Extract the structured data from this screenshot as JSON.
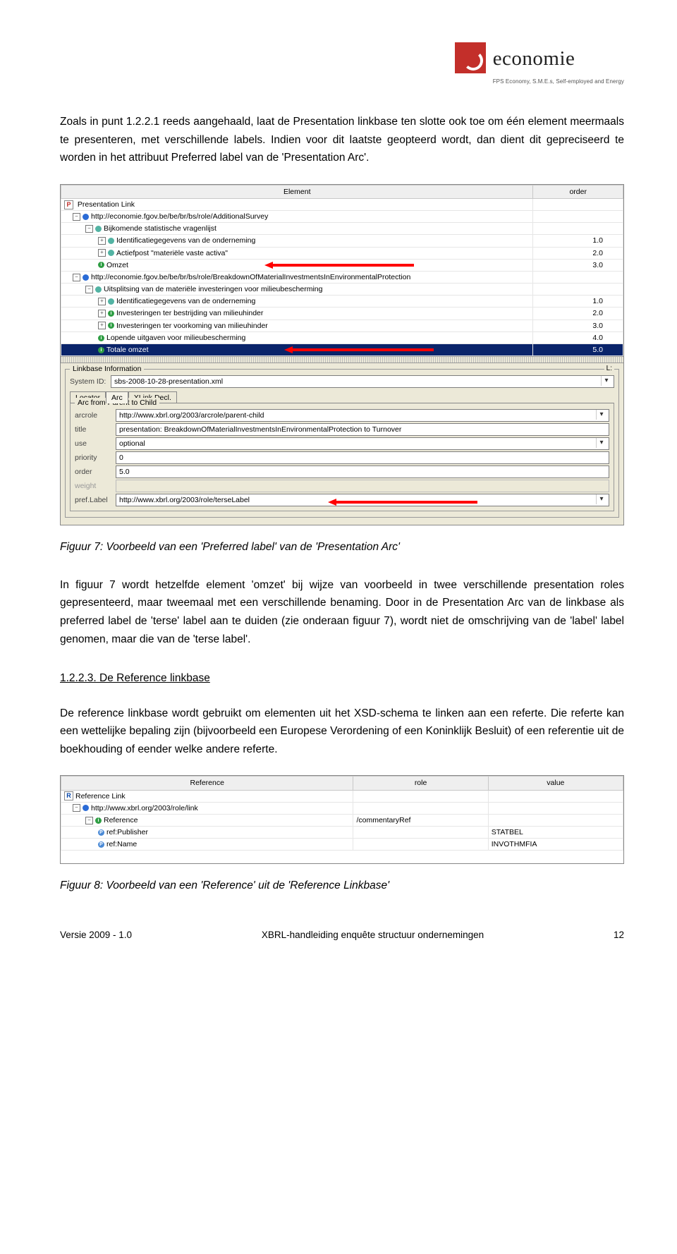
{
  "logo": {
    "name": "economie",
    "tag": "FPS Economy, S.M.E.s, Self-employed and Energy"
  },
  "para1": "Zoals in punt 1.2.2.1 reeds aangehaald, laat de Presentation linkbase ten slotte ook toe om één element meermaals te presenteren, met verschillende labels. Indien voor dit laatste geopteerd wordt, dan dient dit gepreciseerd te worden in het attribuut Preferred label van de 'Presentation Arc'.",
  "figure7": {
    "headers": {
      "element": "Element",
      "order": "order"
    },
    "root": "Presentation Link",
    "rows": [
      {
        "indent": 1,
        "icon": "b-blue",
        "text": "http://economie.fgov.be/be/br/bs/role/AdditionalSurvey",
        "order": ""
      },
      {
        "indent": 2,
        "icon": "b-teal",
        "text": "Bijkomende statistische vragenlijst",
        "order": ""
      },
      {
        "indent": 3,
        "icon": "b-teal",
        "text": "Identificatiegegevens van de onderneming",
        "order": "1.0"
      },
      {
        "indent": 3,
        "icon": "b-teal",
        "text": "Actiefpost \"materiële vaste activa\"",
        "order": "2.0"
      },
      {
        "indent": 3,
        "icon": "b-green-i",
        "text": "Omzet",
        "order": "3.0",
        "redArrow": true
      },
      {
        "indent": 1,
        "icon": "b-blue",
        "text": "http://economie.fgov.be/be/br/bs/role/BreakdownOfMaterialInvestmentsInEnvironmentalProtection",
        "order": ""
      },
      {
        "indent": 2,
        "icon": "b-teal",
        "text": "Uitsplitsing van de materiële investeringen voor milieubescherming",
        "order": ""
      },
      {
        "indent": 3,
        "icon": "b-teal",
        "text": "Identificatiegegevens van de onderneming",
        "order": "1.0"
      },
      {
        "indent": 3,
        "icon": "b-green-i",
        "text": "Investeringen ter bestrijding van milieuhinder",
        "order": "2.0"
      },
      {
        "indent": 3,
        "icon": "b-green-i",
        "text": "Investeringen ter voorkoming van milieuhinder",
        "order": "3.0"
      },
      {
        "indent": 3,
        "icon": "b-green-i",
        "text": "Lopende uitgaven voor milieubescherming",
        "order": "4.0"
      },
      {
        "indent": 3,
        "icon": "b-green-i",
        "text": "Totale omzet",
        "order": "5.0",
        "selected": true,
        "redArrow": true
      }
    ],
    "linkbase": {
      "title": "Linkbase Information",
      "rlabel": "L:",
      "systemId": {
        "label": "System ID:",
        "value": "sbs-2008-10-28-presentation.xml"
      },
      "tabs": [
        "Locator",
        "Arc",
        "XLink Decl."
      ],
      "activeTab": "Arc",
      "fieldset": "Arc from Parent to Child",
      "arcrole": {
        "label": "arcrole",
        "value": "http://www.xbrl.org/2003/arcrole/parent-child"
      },
      "title2": {
        "label": "title",
        "value": "presentation: BreakdownOfMaterialInvestmentsInEnvironmentalProtection to Turnover"
      },
      "use": {
        "label": "use",
        "value": "optional"
      },
      "priority": {
        "label": "priority",
        "value": "0"
      },
      "order": {
        "label": "order",
        "value": "5.0"
      },
      "weight": {
        "label": "weight",
        "value": ""
      },
      "pref": {
        "label": "pref.Label",
        "value": "http://www.xbrl.org/2003/role/terseLabel"
      }
    }
  },
  "caption7": "Figuur 7: Voorbeeld van een 'Preferred label' van de 'Presentation Arc'",
  "para2": "In figuur 7 wordt hetzelfde element 'omzet' bij wijze van voorbeeld in twee verschillende presentation roles gepresenteerd, maar tweemaal met een verschillende benaming. Door in de Presentation Arc van de linkbase als preferred label de 'terse' label aan te duiden (zie onderaan figuur 7), wordt niet de omschrijving van de 'label' label genomen, maar die van de 'terse label'.",
  "section": "1.2.2.3. De Reference linkbase",
  "para3": "De reference linkbase wordt gebruikt om elementen uit het XSD-schema te linken aan een referte. Die referte kan een wettelijke bepaling zijn (bijvoorbeeld een Europese Verordening of een Koninklijk Besluit) of een referentie uit de boekhouding of eender welke andere referte.",
  "figure8": {
    "headers": {
      "ref": "Reference",
      "role": "role",
      "value": "value"
    },
    "root": "Reference Link",
    "rows": [
      {
        "indent": 1,
        "icon": "b-blue",
        "text": "http://www.xbrl.org/2003/role/link",
        "role": "",
        "value": ""
      },
      {
        "indent": 2,
        "icon": "b-green-i",
        "text": "Reference",
        "role": "/commentaryRef",
        "value": ""
      },
      {
        "indent": 3,
        "icon": "pp-icon",
        "text": "ref:Publisher",
        "role": "",
        "value": "STATBEL"
      },
      {
        "indent": 3,
        "icon": "pp-icon",
        "text": "ref:Name",
        "role": "",
        "value": "INVOTHMFIA"
      }
    ]
  },
  "caption8": "Figuur 8: Voorbeeld van een 'Reference' uit de 'Reference Linkbase'",
  "footer": {
    "left": "Versie 2009 - 1.0",
    "center": "XBRL-handleiding enquête structuur ondernemingen",
    "right": "12"
  }
}
